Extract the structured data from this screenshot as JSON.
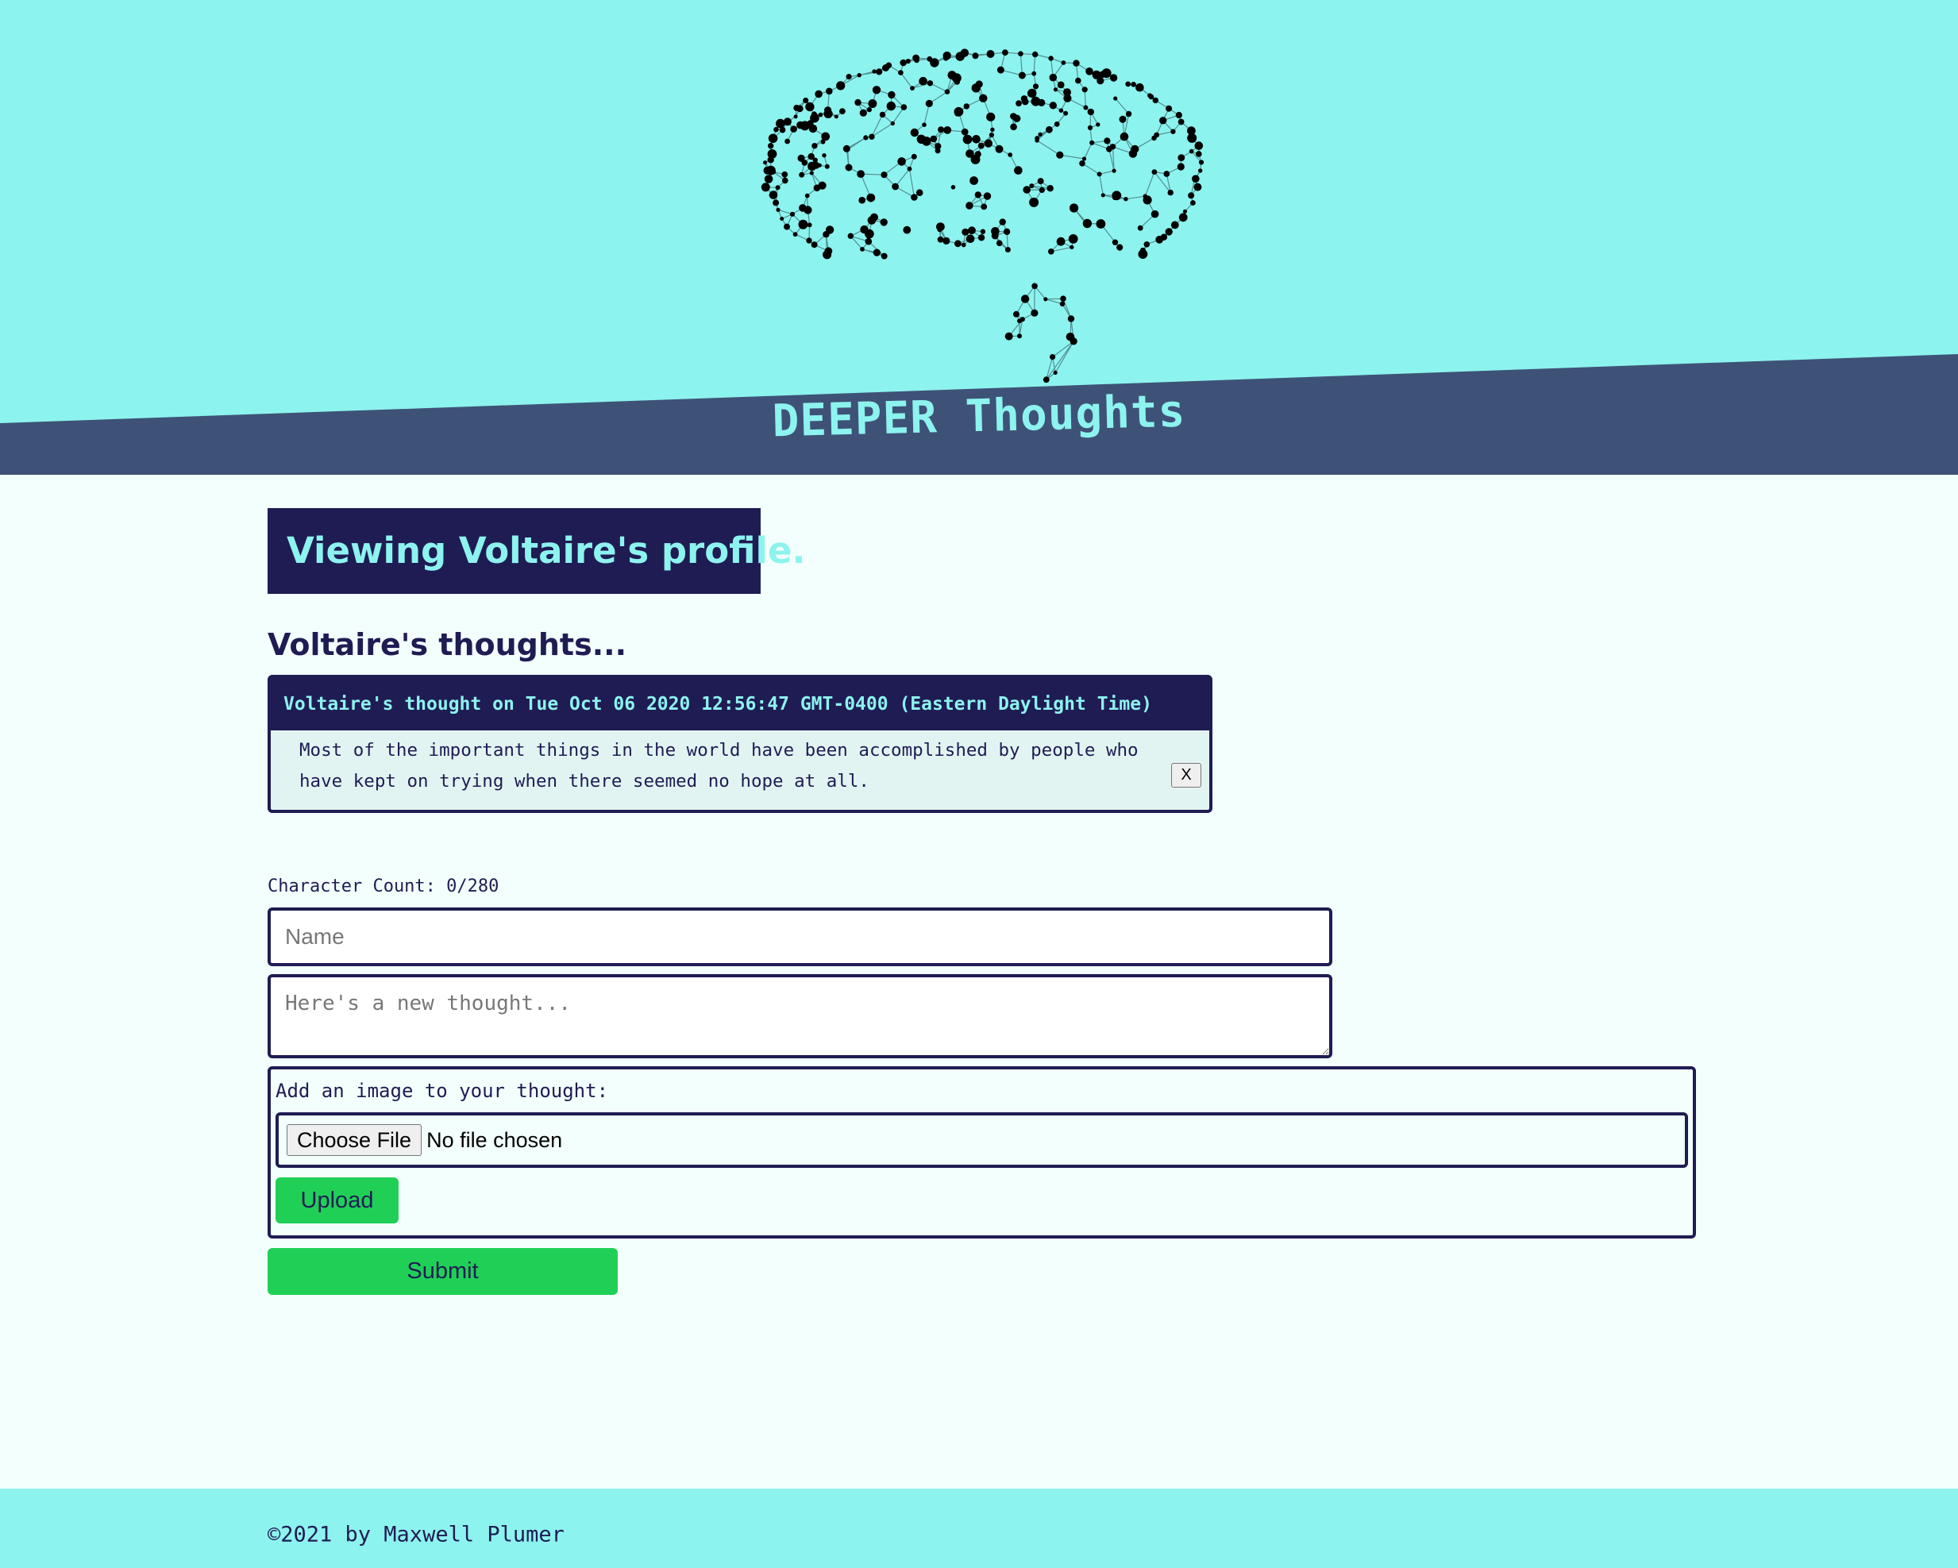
{
  "header": {
    "site_title": "DEEPER Thoughts",
    "logo_icon": "brain-network-icon",
    "colors": {
      "sky": "#8df3ee",
      "band": "#3e5277",
      "ink": "#1f1c54"
    }
  },
  "profile": {
    "banner": "Viewing Voltaire's profile.",
    "thoughts_heading": "Voltaire's thoughts..."
  },
  "thoughts": [
    {
      "header": "Voltaire's thought on Tue Oct 06 2020 12:56:47 GMT-0400 (Eastern Daylight Time)",
      "body": "Most of the important things in the world have been accomplished by people who have kept on trying when there seemed no hope at all.",
      "delete_label": "X"
    }
  ],
  "form": {
    "char_count": "Character Count: 0/280",
    "name_placeholder": "Name",
    "thought_placeholder": "Here's a new thought...",
    "image_label": "Add an image to your thought:",
    "choose_file_label": "Choose File",
    "file_status": "No file chosen",
    "upload_label": "Upload",
    "submit_label": "Submit",
    "button_color": "#20d056"
  },
  "footer": {
    "text": "©2021 by Maxwell Plumer"
  }
}
